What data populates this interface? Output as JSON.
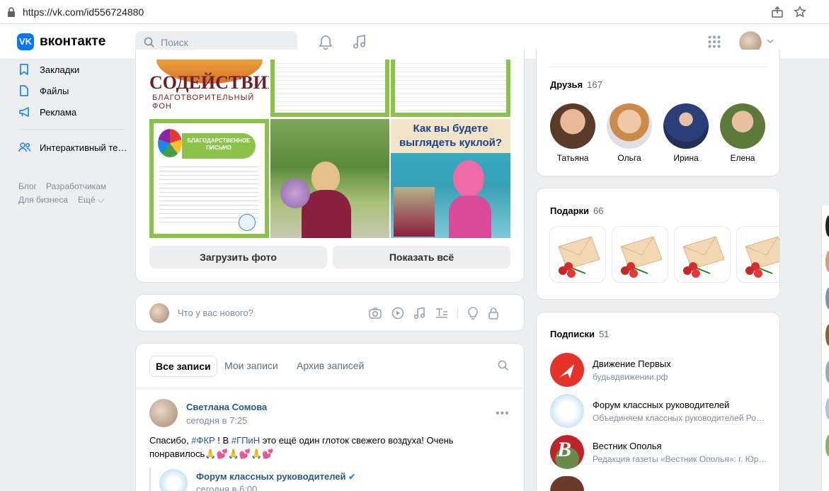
{
  "browser": {
    "url": "https://vk.com/id556724880"
  },
  "header": {
    "logo_text": "вконтакте",
    "logo_glyph": "VK",
    "search_placeholder": "Поиск"
  },
  "left_menu": {
    "items": [
      {
        "label": "Закладки",
        "icon": "bookmark-icon"
      },
      {
        "label": "Файлы",
        "icon": "file-icon"
      },
      {
        "label": "Реклама",
        "icon": "megaphone-icon"
      },
      {
        "label": "Интерактивный те…",
        "icon": "users-icon"
      }
    ],
    "footer": {
      "blog": "Блог",
      "developers": "Разработчикам",
      "business": "Для бизнеса",
      "more": "Ещё"
    }
  },
  "photos": {
    "banner_text": "СОДЕЙСТВИЕ",
    "banner_sub": "БЛАГОТВОРИТЕЛЬНЫЙ ФОН",
    "diploma_title": "БЛАГОДАРСТВЕННОЕ ПИСЬМО",
    "doll_caption": "Как вы будете выглядеть куклой?",
    "upload_button": "Загрузить фото",
    "show_all_button": "Показать всё"
  },
  "composer": {
    "placeholder": "Что у вас нового?"
  },
  "wall": {
    "tabs": [
      "Все записи",
      "Мои записи",
      "Архив записей"
    ],
    "post": {
      "author": "Светлана Сомова",
      "time": "сегодня в 7:25",
      "text_prefix": "Спасибо, ",
      "tag1": "#ФКР",
      "text_mid": " ! В ",
      "tag2": "#ГПиН",
      "text_suffix": " это ещё один глоток свежего воздуха! Очень понравилось🙏💕🙏💕🙏💕",
      "repost_author": "Форум классных руководителей",
      "repost_time": "сегодня в 6:00"
    }
  },
  "friends": {
    "title": "Друзья",
    "count": "167",
    "items": [
      {
        "name": "Татьяна",
        "color": "#c98a5e"
      },
      {
        "name": "Ольга",
        "color": "#d9a28a"
      },
      {
        "name": "Ирина",
        "color": "#3a4f7a"
      },
      {
        "name": "Елена",
        "color": "#8a9a5a"
      }
    ]
  },
  "gifts": {
    "title": "Подарки",
    "count": "66"
  },
  "subscriptions": {
    "title": "Подписки",
    "count": "51",
    "items": [
      {
        "name": "Движение Первых",
        "desc": "будьвдвижении.рф",
        "color": "#e5332a"
      },
      {
        "name": "Форум классных руководителей",
        "desc": "Объединяем классных руководителей Ро…",
        "color": "#4a90d9"
      },
      {
        "name": "Вестник Ополья",
        "desc": "Редакция газеты «Вестник Ополья»: г. Юр…",
        "color": "#c0242b"
      }
    ]
  }
}
